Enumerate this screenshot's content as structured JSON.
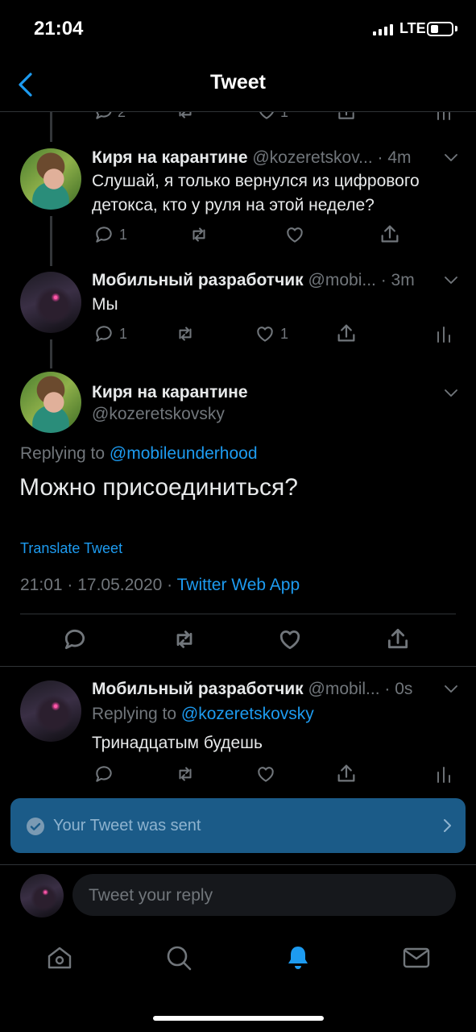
{
  "status": {
    "time": "21:04",
    "network": "LTE"
  },
  "nav": {
    "title": "Tweet",
    "back_icon": "chevron-left-icon"
  },
  "partial_tweet": {
    "replies": "2",
    "likes": "1"
  },
  "tweet1": {
    "author": "Киря на карантине",
    "handle": "@kozeretskov...",
    "time": "· 4m",
    "text_line1": "Слушай, я только вернулся из цифрового",
    "text_line2": "детокса, кто у руля на этой неделе?",
    "replies": "1"
  },
  "tweet2": {
    "author": "Мобильный разработчик",
    "handle": "@mobi...",
    "time": "· 3m",
    "text": "Мы",
    "replies": "1",
    "likes": "1"
  },
  "main_tweet": {
    "author": "Киря на карантине",
    "handle": "@kozeretskovsky",
    "replying_prefix": "Replying to",
    "replying_to": "@mobileunderhood",
    "text": "Можно присоединиться?",
    "translate": "Translate Tweet",
    "timestamp": "21:01 · 17.05.2020 ·",
    "source": "Twitter Web App"
  },
  "reply_tweet": {
    "author": "Мобильный разработчик",
    "handle": "@mobil...",
    "time": "· 0s",
    "replying_prefix": "Replying to",
    "replying_to": "@kozeretskovsky",
    "text": "Тринадцатым будешь"
  },
  "toast": {
    "text": "Your Tweet was sent"
  },
  "reply_box": {
    "placeholder": "Tweet your reply"
  },
  "tabbar": [
    "home-icon",
    "search-icon",
    "notifications-icon",
    "messages-icon"
  ],
  "colors": {
    "accent": "#1d9bf0",
    "background": "#000000",
    "toast": "#1b5b88"
  }
}
